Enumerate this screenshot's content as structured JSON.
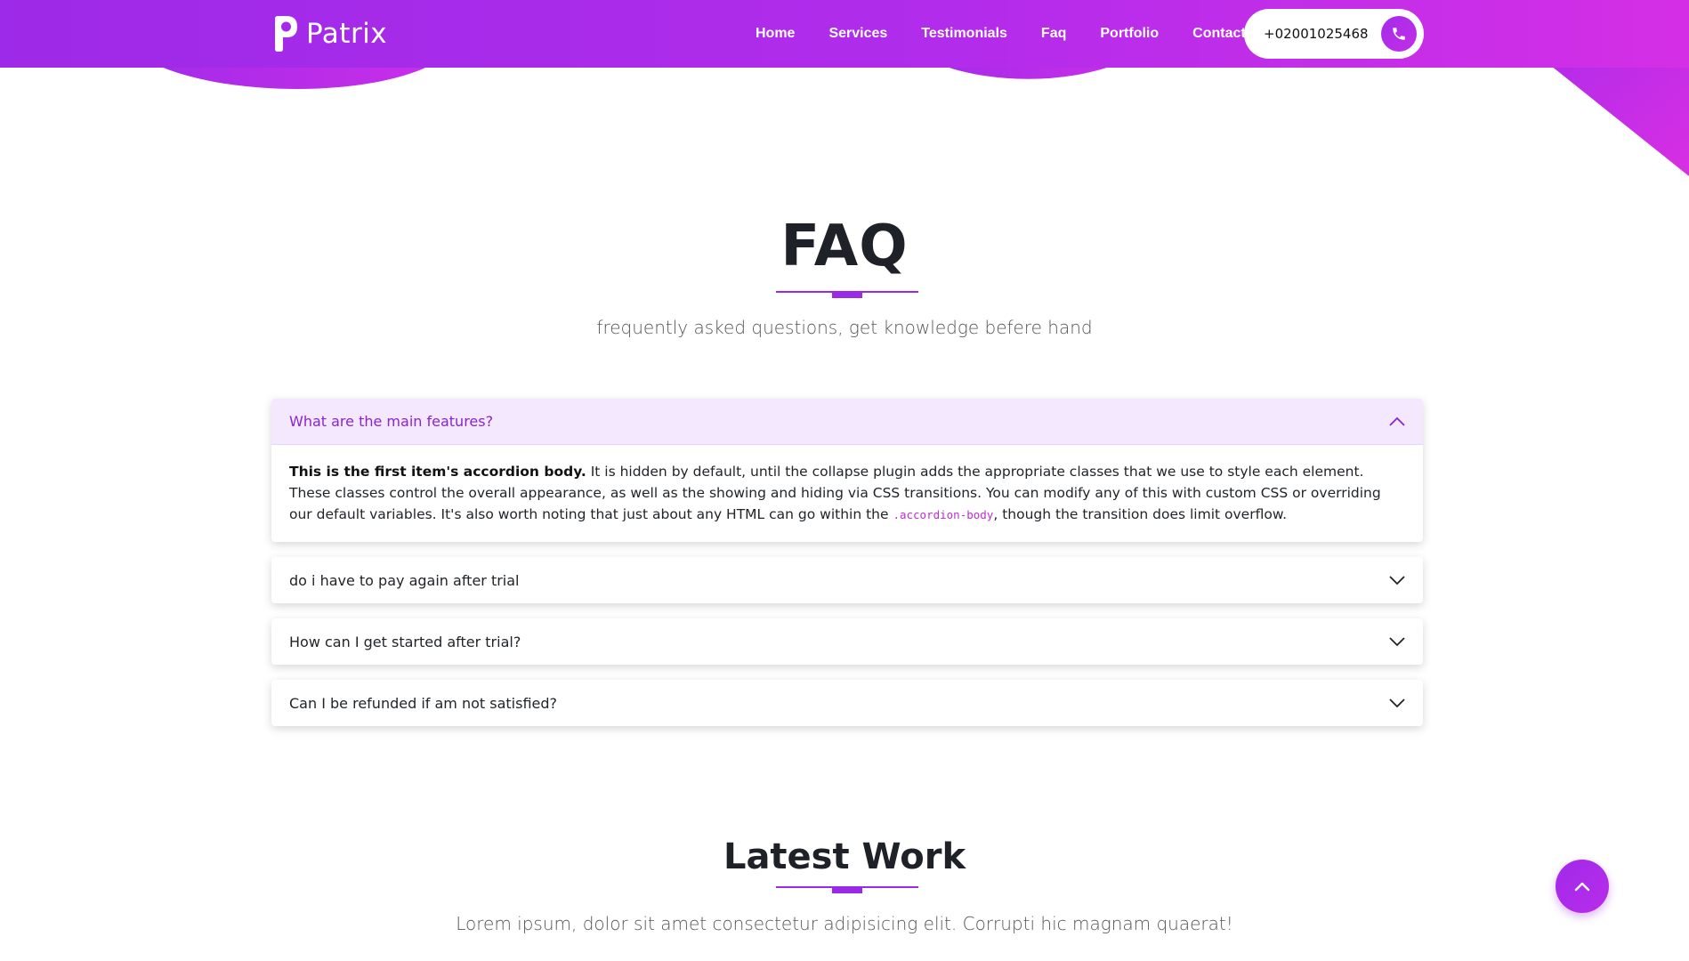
{
  "brand": {
    "name": "Patrix"
  },
  "nav": {
    "items": [
      "Home",
      "Services",
      "Testimonials",
      "Faq",
      "Portfolio",
      "Contact"
    ],
    "phone": "+02001025468"
  },
  "colors": {
    "accent": "#9b2ae8",
    "accent_light": "#f3e8fd",
    "header_start": "#9d2ae8",
    "header_end": "#d42fe6"
  },
  "faq": {
    "title": "FAQ",
    "subtitle": "frequently asked questions, get knowledge befere hand",
    "items": [
      {
        "question": "What are the main features?",
        "open": true,
        "answer_strong": "This is the first item's accordion body.",
        "answer_text": " It is hidden by default, until the collapse plugin adds the appropriate classes that we use to style each element. These classes control the overall appearance, as well as the showing and hiding via CSS transitions. You can modify any of this with custom CSS or overriding our default variables. It's also worth noting that just about any HTML can go within the ",
        "answer_code": ".accordion-body",
        "answer_tail": ", though the transition does limit overflow."
      },
      {
        "question": "do i have to pay again after trial",
        "open": false
      },
      {
        "question": "How can I get started after trial?",
        "open": false
      },
      {
        "question": "Can I be refunded if am not satisfied?",
        "open": false
      }
    ]
  },
  "work": {
    "title": "Latest Work",
    "subtitle": "Lorem ipsum, dolor sit amet consectetur adipisicing elit. Corrupti hic magnam quaerat!"
  },
  "icons": {
    "phone": "phone-icon",
    "chevron_up": "chevron-up-icon",
    "chevron_down": "chevron-down-icon",
    "scroll_top": "arrow-up-icon"
  }
}
